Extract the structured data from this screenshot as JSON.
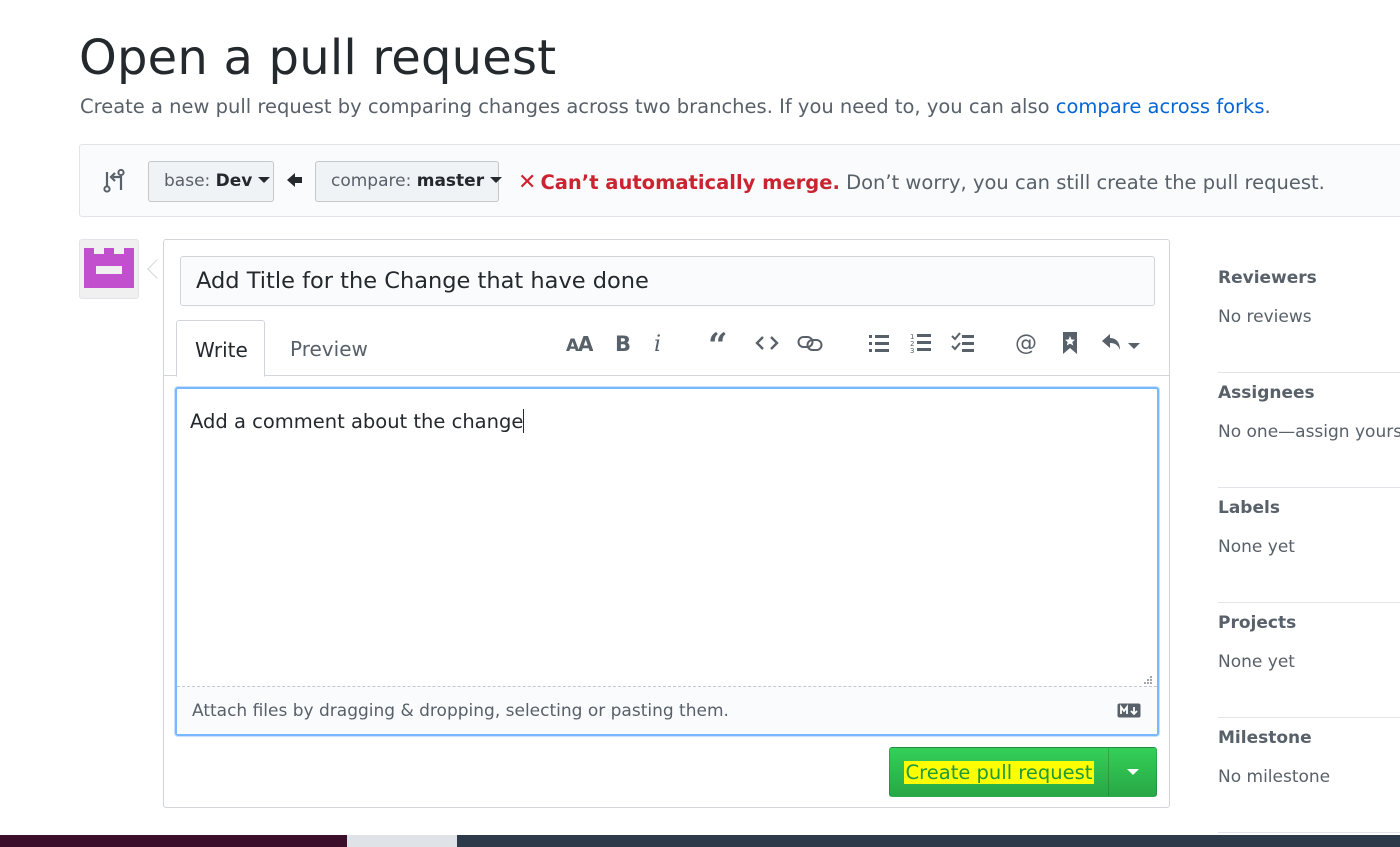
{
  "page": {
    "title": "Open a pull request",
    "subtitle": "Create a new pull request by comparing changes across two branches. If you need to, you can also ",
    "forks_link": "compare across forks",
    "subtitle_end": "."
  },
  "range": {
    "base_prefix": "base: ",
    "base_branch": "Dev",
    "compare_prefix": "compare: ",
    "compare_branch": "master",
    "status_icon": "x-icon",
    "status_error": "Can’t automatically merge.",
    "status_hint": " Don’t worry, you can still create the pull request."
  },
  "form": {
    "title_value": "Add Title for the Change that have done",
    "tabs": [
      {
        "label": "Write"
      },
      {
        "label": "Preview"
      }
    ],
    "toolbar_icons": [
      "text-size-icon",
      "bold-icon",
      "italic-icon",
      "quote-icon",
      "code-icon",
      "link-icon",
      "bulleted-list-icon",
      "numbered-list-icon",
      "task-list-icon",
      "mention-icon",
      "saved-reply-icon",
      "reply-dropdown-icon"
    ],
    "comment_value": "Add a comment about the change",
    "attach_text": "Attach files by dragging & dropping, selecting or pasting them.",
    "submit_label": "Create pull request"
  },
  "sidebar": {
    "sections": [
      {
        "heading": "Reviewers",
        "value": "No reviews"
      },
      {
        "heading": "Assignees",
        "value": "No one—assign yourse"
      },
      {
        "heading": "Labels",
        "value": "None yet"
      },
      {
        "heading": "Projects",
        "value": "None yet"
      },
      {
        "heading": "Milestone",
        "value": "No milestone"
      }
    ]
  },
  "colors": {
    "link": "#0366d6",
    "error": "#cb2431",
    "primary_button": "#28a745",
    "avatar": "#c24fcd",
    "highlight": "#ffff00"
  }
}
